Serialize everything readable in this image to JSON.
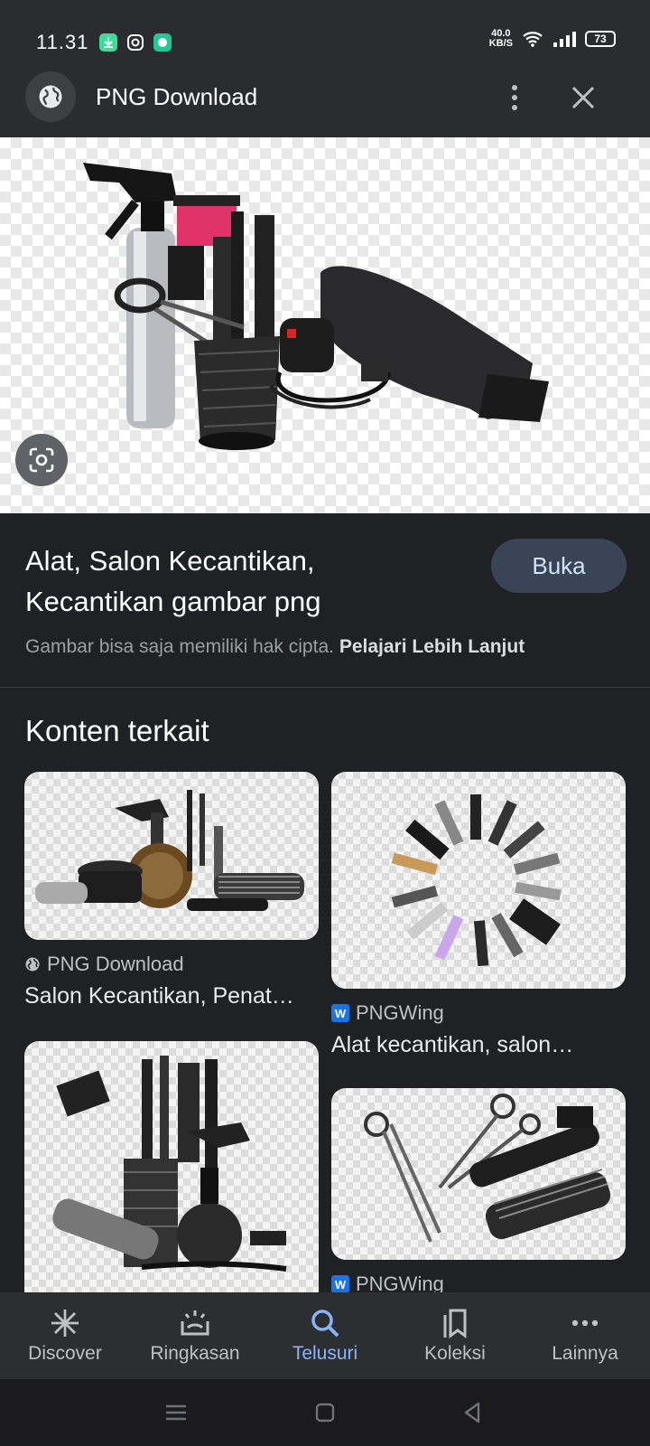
{
  "status_bar": {
    "time": "11.31",
    "net_speed_value": "40.0",
    "net_speed_unit": "KB/S",
    "battery": "73"
  },
  "header": {
    "title": "PNG Download",
    "site_icon": "globe-icon",
    "menu_icon": "more-vert-icon",
    "close_icon": "close-icon"
  },
  "result": {
    "title": "Alat, Salon Kecantikan, Kecantikan gambar png",
    "open_button": "Buka",
    "copyright_text": "Gambar bisa saja memiliki hak cipta.",
    "learn_more": "Pelajari Lebih Lanjut"
  },
  "related": {
    "heading": "Konten terkait",
    "items": [
      {
        "source": "PNG Download",
        "title": "Salon Kecantikan, Penat…",
        "source_icon": "globe-icon"
      },
      {
        "source": "PNGWing",
        "title": "Alat kecantikan, salon…",
        "source_icon": "pngwing-icon"
      },
      {
        "source": "PNGWing",
        "title": "",
        "source_icon": "pngwing-icon"
      }
    ]
  },
  "bottom_nav": {
    "items": [
      {
        "label": "Discover",
        "icon": "asterisk-icon"
      },
      {
        "label": "Ringkasan",
        "icon": "summary-icon"
      },
      {
        "label": "Telusuri",
        "icon": "search-icon",
        "active": true
      },
      {
        "label": "Koleksi",
        "icon": "collections-icon"
      },
      {
        "label": "Lainnya",
        "icon": "more-horiz-icon"
      }
    ]
  },
  "colors": {
    "background": "#202124",
    "header": "#2b2c30",
    "button_bg": "#394457",
    "accent": "#8ab4f8"
  }
}
